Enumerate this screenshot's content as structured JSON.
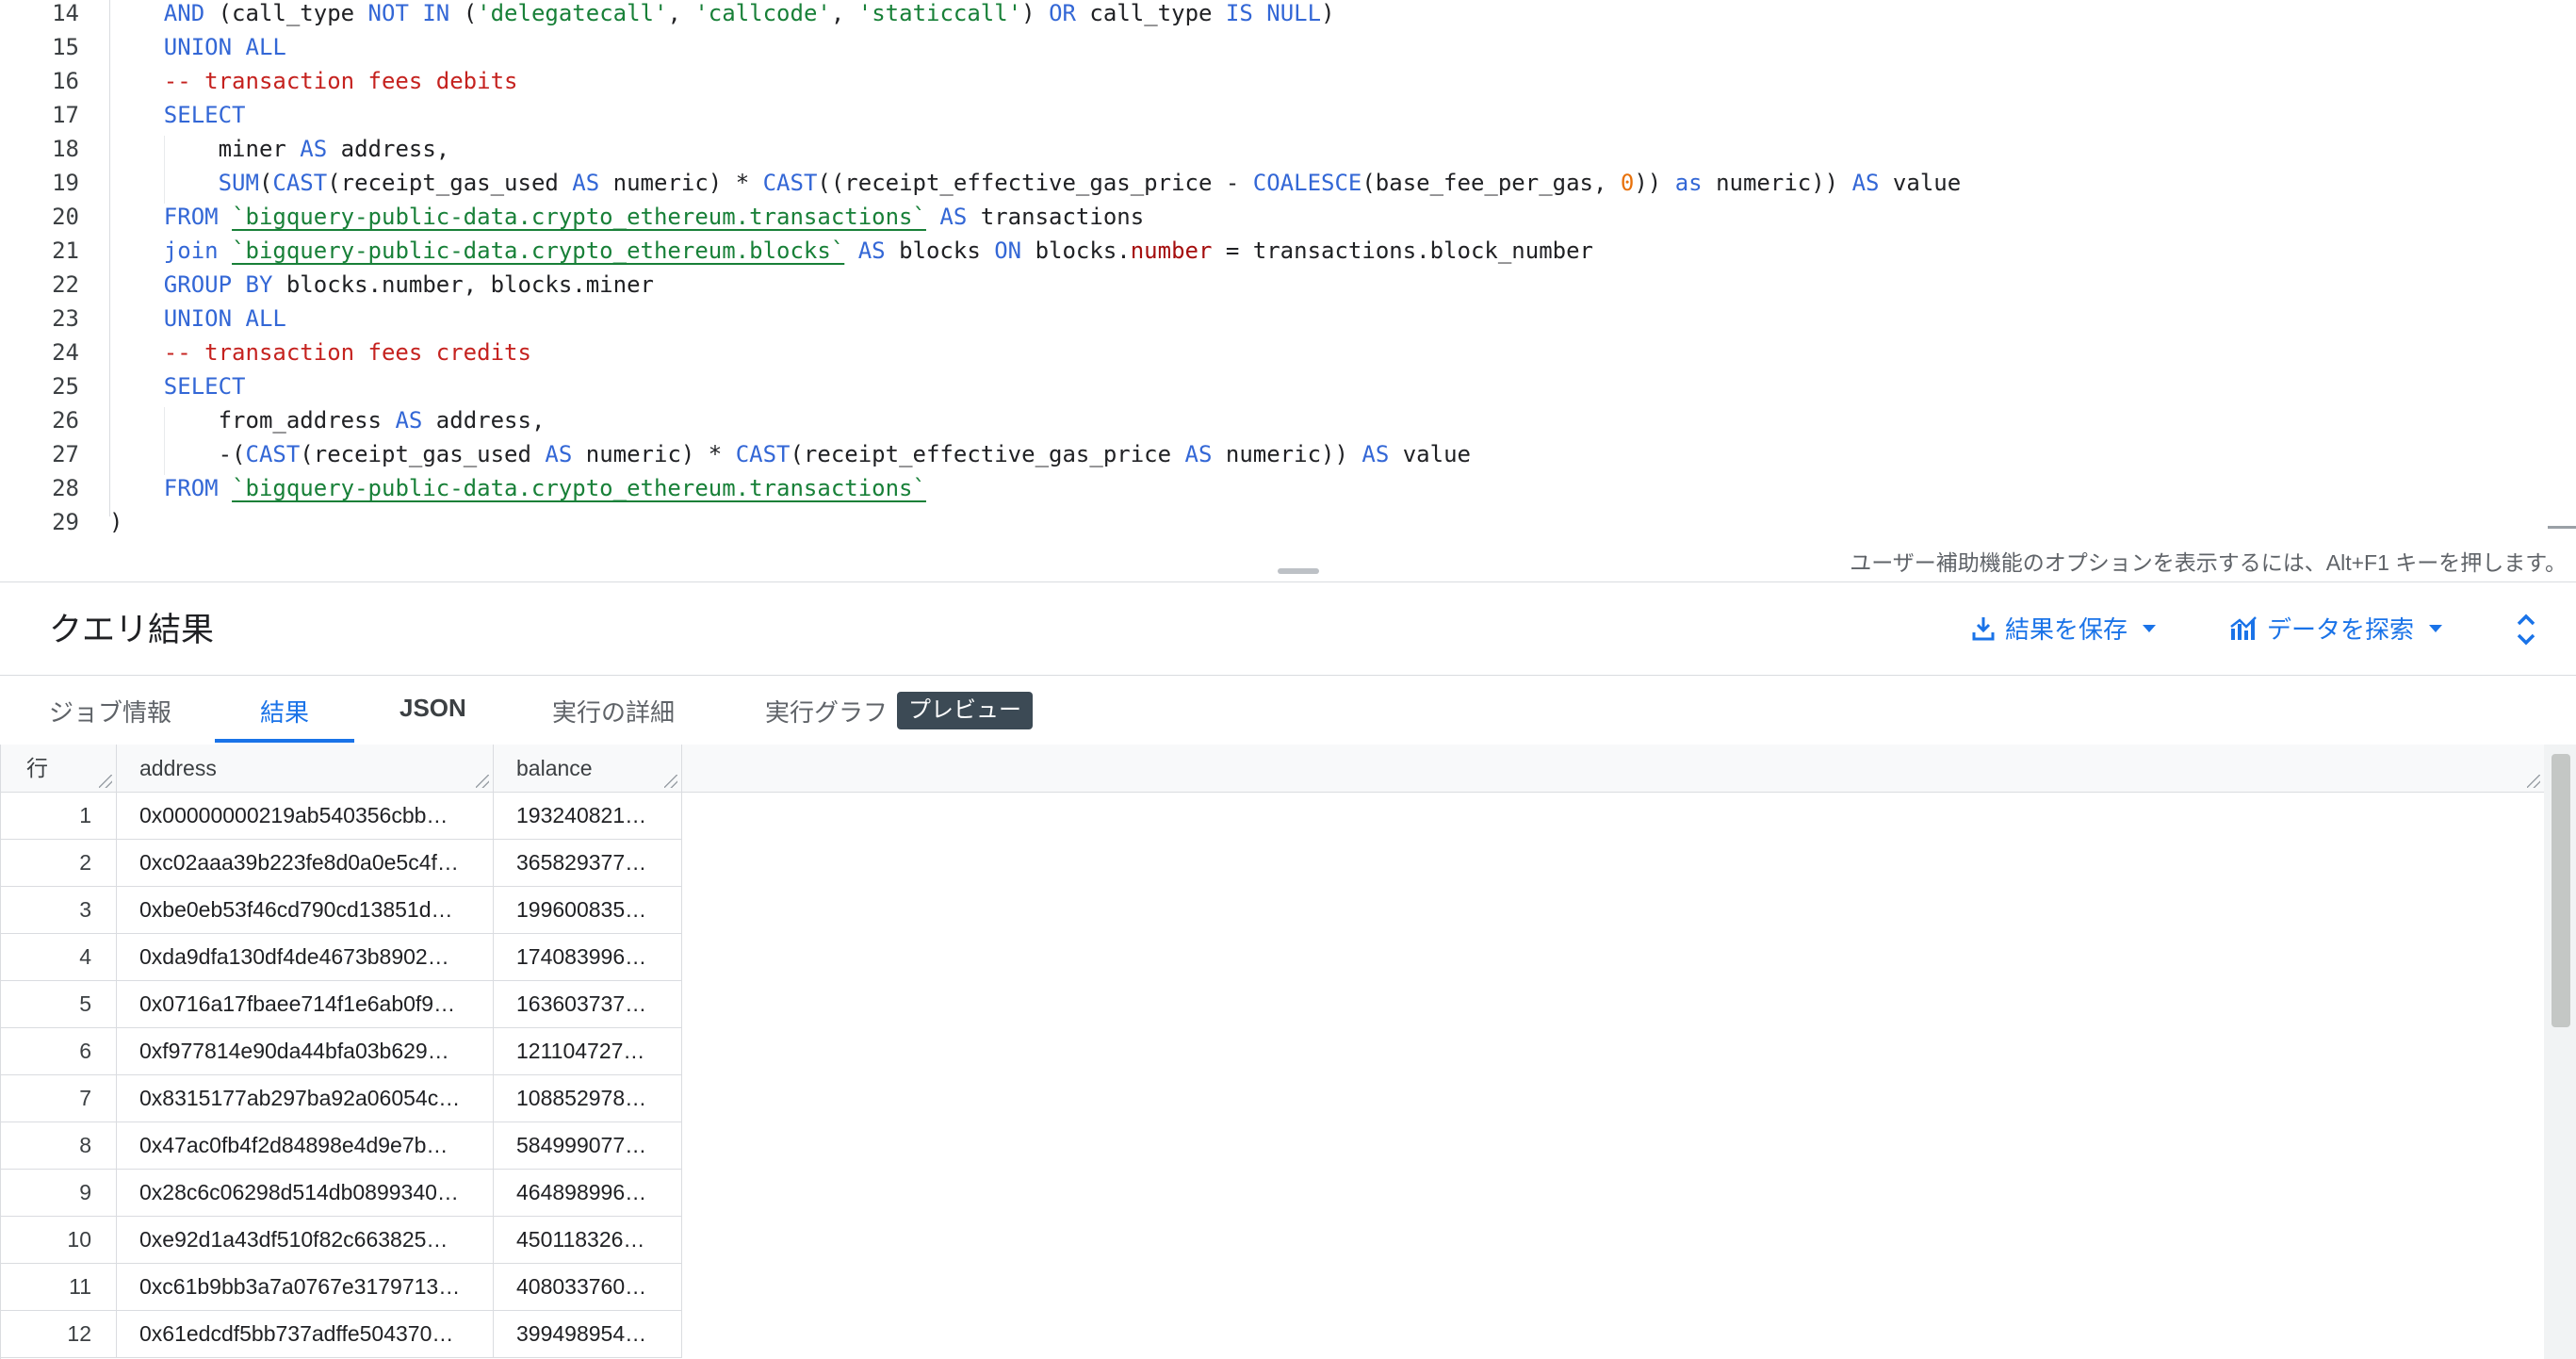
{
  "editor": {
    "lines": [
      {
        "n": "14",
        "segs": [
          [
            "    ",
            ""
          ],
          [
            "AND",
            "kw"
          ],
          [
            " (call_type ",
            ""
          ],
          [
            "NOT IN",
            "kw"
          ],
          [
            " (",
            ""
          ],
          [
            "'delegatecall'",
            "str"
          ],
          [
            ", ",
            ""
          ],
          [
            "'callcode'",
            "str"
          ],
          [
            ", ",
            ""
          ],
          [
            "'staticcall'",
            "str"
          ],
          [
            ") ",
            ""
          ],
          [
            "OR",
            "kw"
          ],
          [
            " call_type ",
            ""
          ],
          [
            "IS NULL",
            "kw"
          ],
          [
            ")",
            ""
          ]
        ]
      },
      {
        "n": "15",
        "segs": [
          [
            "    ",
            ""
          ],
          [
            "UNION ALL",
            "kw"
          ]
        ]
      },
      {
        "n": "16",
        "segs": [
          [
            "    ",
            ""
          ],
          [
            "-- transaction fees debits",
            "cm"
          ]
        ]
      },
      {
        "n": "17",
        "segs": [
          [
            "    ",
            ""
          ],
          [
            "SELECT",
            "kw"
          ]
        ]
      },
      {
        "n": "18",
        "segs": [
          [
            "        miner ",
            ""
          ],
          [
            "AS",
            "kw"
          ],
          [
            " address,",
            ""
          ]
        ]
      },
      {
        "n": "19",
        "segs": [
          [
            "        ",
            ""
          ],
          [
            "SUM",
            "kw"
          ],
          [
            "(",
            ""
          ],
          [
            "CAST",
            "kw"
          ],
          [
            "(receipt_gas_used ",
            ""
          ],
          [
            "AS",
            "kw"
          ],
          [
            " numeric) * ",
            ""
          ],
          [
            "CAST",
            "kw"
          ],
          [
            "((receipt_effective_gas_price - ",
            ""
          ],
          [
            "COALESCE",
            "kw"
          ],
          [
            "(base_fee_per_gas, ",
            ""
          ],
          [
            "0",
            "num"
          ],
          [
            ")) ",
            ""
          ],
          [
            "as",
            "kw"
          ],
          [
            " numeric)) ",
            ""
          ],
          [
            "AS",
            "kw"
          ],
          [
            " value",
            ""
          ]
        ]
      },
      {
        "n": "20",
        "segs": [
          [
            "    ",
            ""
          ],
          [
            "FROM",
            "kw"
          ],
          [
            " ",
            ""
          ],
          [
            "`bigquery-public-data.crypto_ethereum.transactions`",
            "tbl"
          ],
          [
            " ",
            ""
          ],
          [
            "AS",
            "kw"
          ],
          [
            " transactions",
            ""
          ]
        ]
      },
      {
        "n": "21",
        "segs": [
          [
            "    ",
            ""
          ],
          [
            "join",
            "kw"
          ],
          [
            " ",
            ""
          ],
          [
            "`bigquery-public-data.crypto_ethereum.blocks`",
            "tbl"
          ],
          [
            " ",
            ""
          ],
          [
            "AS",
            "kw"
          ],
          [
            " blocks ",
            ""
          ],
          [
            "ON",
            "kw"
          ],
          [
            " blocks.",
            ""
          ],
          [
            "number",
            "prop"
          ],
          [
            " = transactions.block_number",
            ""
          ]
        ]
      },
      {
        "n": "22",
        "segs": [
          [
            "    ",
            ""
          ],
          [
            "GROUP BY",
            "kw"
          ],
          [
            " blocks.number, blocks.miner",
            ""
          ]
        ]
      },
      {
        "n": "23",
        "segs": [
          [
            "    ",
            ""
          ],
          [
            "UNION ALL",
            "kw"
          ]
        ]
      },
      {
        "n": "24",
        "segs": [
          [
            "    ",
            ""
          ],
          [
            "-- transaction fees credits",
            "cm"
          ]
        ]
      },
      {
        "n": "25",
        "segs": [
          [
            "    ",
            ""
          ],
          [
            "SELECT",
            "kw"
          ]
        ]
      },
      {
        "n": "26",
        "segs": [
          [
            "        from_address ",
            ""
          ],
          [
            "AS",
            "kw"
          ],
          [
            " address,",
            ""
          ]
        ]
      },
      {
        "n": "27",
        "segs": [
          [
            "        -(",
            ""
          ],
          [
            "CAST",
            "kw"
          ],
          [
            "(receipt_gas_used ",
            ""
          ],
          [
            "AS",
            "kw"
          ],
          [
            " numeric) * ",
            ""
          ],
          [
            "CAST",
            "kw"
          ],
          [
            "(receipt_effective_gas_price ",
            ""
          ],
          [
            "AS",
            "kw"
          ],
          [
            " numeric)) ",
            ""
          ],
          [
            "AS",
            "kw"
          ],
          [
            " value",
            ""
          ]
        ]
      },
      {
        "n": "28",
        "segs": [
          [
            "    ",
            ""
          ],
          [
            "FROM",
            "kw"
          ],
          [
            " ",
            ""
          ],
          [
            "`bigquery-public-data.crypto_ethereum.transactions`",
            "tbl"
          ]
        ]
      },
      {
        "n": "29",
        "segs": [
          [
            ")",
            ""
          ]
        ]
      }
    ],
    "a11y_hint": "ユーザー補助機能のオプションを表示するには、Alt+F1 キーを押します。"
  },
  "results": {
    "title": "クエリ結果",
    "save_label": "結果を保存",
    "explore_label": "データを探索"
  },
  "tabs": [
    {
      "id": "job",
      "label": "ジョブ情報"
    },
    {
      "id": "results",
      "label": "結果"
    },
    {
      "id": "json",
      "label": "JSON"
    },
    {
      "id": "details",
      "label": "実行の詳細"
    },
    {
      "id": "graph",
      "label": "実行グラフ"
    }
  ],
  "preview_badge": "プレビュー",
  "table": {
    "columns": [
      "行",
      "address",
      "balance"
    ],
    "rows": [
      [
        "1",
        "0x00000000219ab540356cbb…",
        "193240821…"
      ],
      [
        "2",
        "0xc02aaa39b223fe8d0a0e5c4f…",
        "365829377…"
      ],
      [
        "3",
        "0xbe0eb53f46cd790cd13851d…",
        "199600835…"
      ],
      [
        "4",
        "0xda9dfa130df4de4673b8902…",
        "174083996…"
      ],
      [
        "5",
        "0x0716a17fbaee714f1e6ab0f9…",
        "163603737…"
      ],
      [
        "6",
        "0xf977814e90da44bfa03b629…",
        "121104727…"
      ],
      [
        "7",
        "0x8315177ab297ba92a06054c…",
        "108852978…"
      ],
      [
        "8",
        "0x47ac0fb4f2d84898e4d9e7b…",
        "584999077…"
      ],
      [
        "9",
        "0x28c6c06298d514db0899340…",
        "464898996…"
      ],
      [
        "10",
        "0xe92d1a43df510f82c663825…",
        "450118326…"
      ],
      [
        "11",
        "0xc61b9bb3a7a0767e3179713…",
        "408033760…"
      ],
      [
        "12",
        "0x61edcdf5bb737adffe504370…",
        "399498954…"
      ]
    ]
  },
  "icons": {
    "save": "download-icon",
    "explore": "chart-icon",
    "expand": "unfold-icon"
  },
  "colors": {
    "accent": "#1a73e8",
    "keyword": "#3367d6",
    "string": "#188038",
    "comment": "#c5221f",
    "number": "#e8710a"
  }
}
